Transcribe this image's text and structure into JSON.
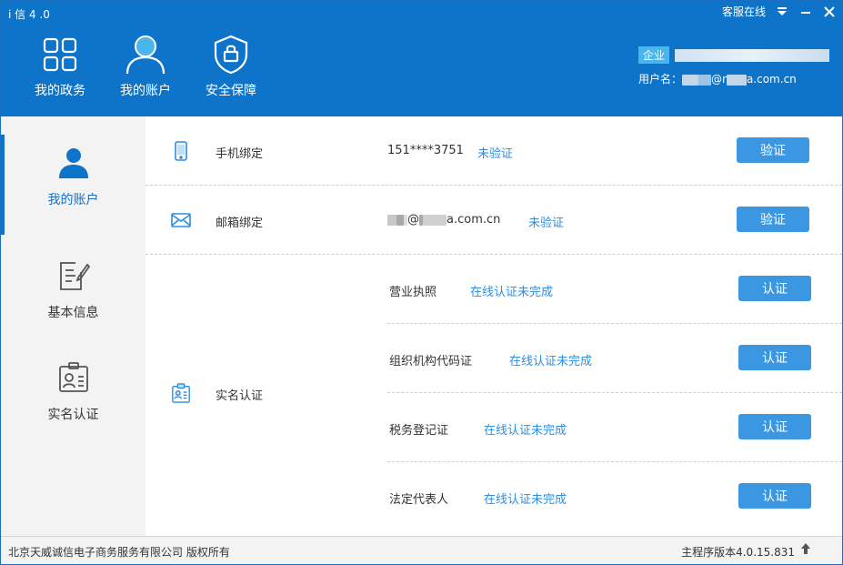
{
  "window": {
    "title": "i 信 4 .0",
    "service_label": "客服在线"
  },
  "nav": {
    "items": [
      {
        "label": "我的政务",
        "icon": "grid-icon"
      },
      {
        "label": "我的账户",
        "icon": "user-icon"
      },
      {
        "label": "安全保障",
        "icon": "shield-lock-icon"
      }
    ]
  },
  "user": {
    "badge": "企业",
    "company_name": "",
    "username_prefix": "用户名：",
    "username_tail": "a.com.cn"
  },
  "sidebar": {
    "items": [
      {
        "label": "我的账户",
        "icon": "user-icon",
        "active": true
      },
      {
        "label": "基本信息",
        "icon": "edit-document-icon",
        "active": false
      },
      {
        "label": "实名认证",
        "icon": "id-card-icon",
        "active": false
      }
    ]
  },
  "account": {
    "phone": {
      "title": "手机绑定",
      "value": "151****3751",
      "status": "未验证",
      "button": "验证"
    },
    "email": {
      "title": "邮箱绑定",
      "value_tail": "a.com.cn",
      "status": "未验证",
      "button": "验证"
    },
    "realname": {
      "title": "实名认证",
      "items": [
        {
          "name": "营业执照",
          "status": "在线认证未完成",
          "button": "认证"
        },
        {
          "name": "组织机构代码证",
          "status": "在线认证未完成",
          "button": "认证"
        },
        {
          "name": "税务登记证",
          "status": "在线认证未完成",
          "button": "认证"
        },
        {
          "name": "法定代表人",
          "status": "在线认证未完成",
          "button": "认证"
        }
      ]
    }
  },
  "footer": {
    "copyright": "北京天威诚信电子商务服务有限公司 版权所有",
    "version": "主程序版本4.0.15.831"
  },
  "colors": {
    "header_bg": "#0e74c9",
    "accent": "#3b97e2",
    "status_text": "#2d8ee0",
    "sidebar_bg": "#f3f3f3"
  }
}
